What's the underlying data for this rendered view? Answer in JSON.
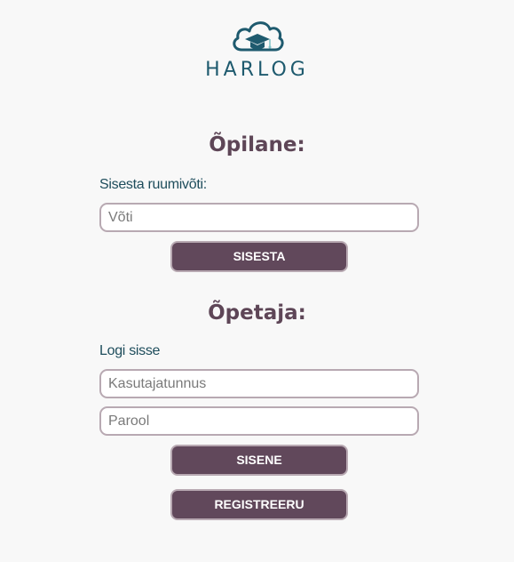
{
  "logo": {
    "name": "HARLOG",
    "icon": "cloud-graduation-cap-icon"
  },
  "student": {
    "heading": "Õpilane:",
    "key_label": "Sisesta ruumivõti:",
    "key_placeholder": "Võti",
    "submit_label": "SISESTA"
  },
  "teacher": {
    "heading": "Õpetaja:",
    "login_label": "Logi sisse",
    "username_placeholder": "Kasutajatunnus",
    "password_placeholder": "Parool",
    "login_button": "SISENE",
    "register_button": "REGISTREERU"
  },
  "colors": {
    "brand_teal": "#1e5a6e",
    "heading_purple": "#5e4657",
    "button_bg": "#61485b",
    "input_border": "#b8a9b2",
    "background": "#f8f8f8"
  }
}
